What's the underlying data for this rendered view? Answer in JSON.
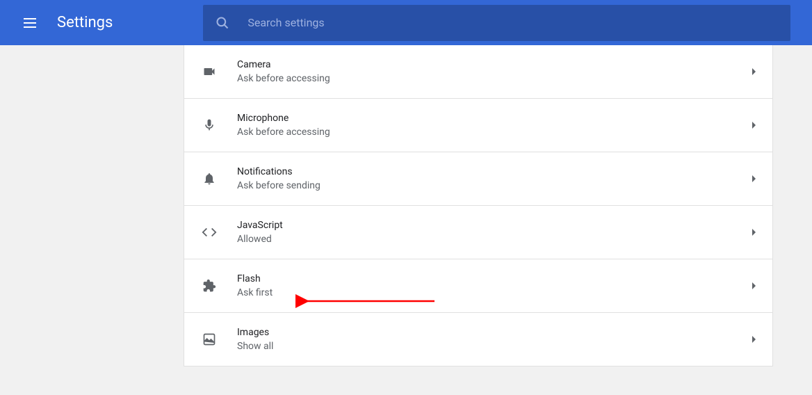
{
  "header": {
    "title": "Settings",
    "search_placeholder": "Search settings"
  },
  "settings": [
    {
      "icon": "camera",
      "title": "Camera",
      "subtitle": "Ask before accessing"
    },
    {
      "icon": "microphone",
      "title": "Microphone",
      "subtitle": "Ask before accessing"
    },
    {
      "icon": "notifications",
      "title": "Notifications",
      "subtitle": "Ask before sending"
    },
    {
      "icon": "javascript",
      "title": "JavaScript",
      "subtitle": "Allowed"
    },
    {
      "icon": "flash",
      "title": "Flash",
      "subtitle": "Ask first"
    },
    {
      "icon": "images",
      "title": "Images",
      "subtitle": "Show all"
    }
  ],
  "annotation": {
    "type": "arrow",
    "target": "flash"
  }
}
